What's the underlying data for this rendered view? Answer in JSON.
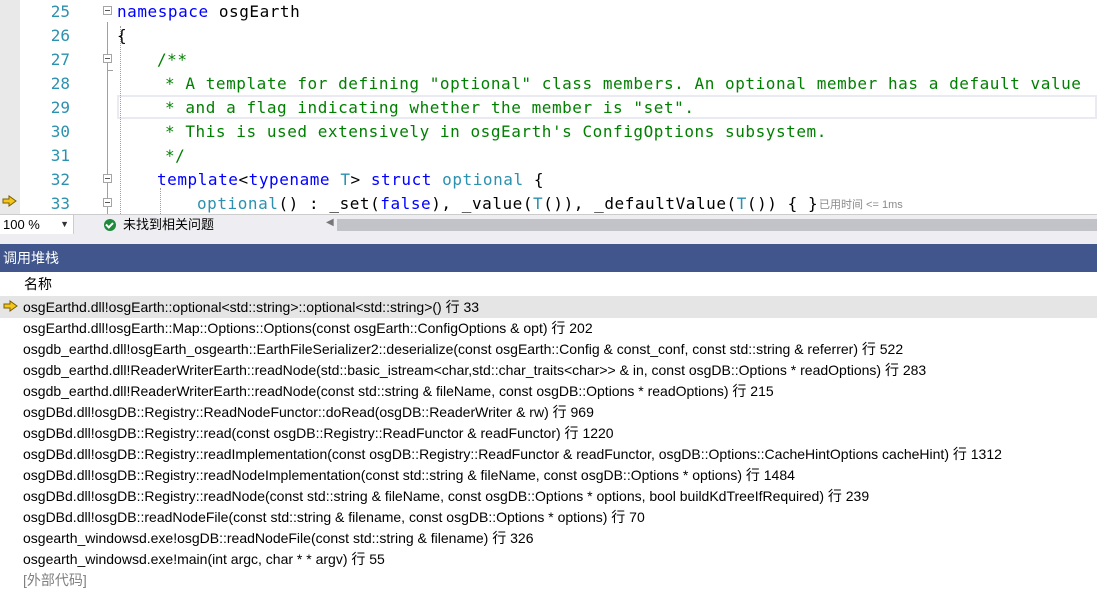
{
  "editor": {
    "lines": [
      {
        "num": "25",
        "tokens": [
          {
            "t": "namespace",
            "c": "kw"
          },
          {
            "t": " osgEarth",
            "c": "pl"
          }
        ]
      },
      {
        "num": "26",
        "tokens": [
          {
            "t": "{",
            "c": "pl"
          }
        ]
      },
      {
        "num": "27",
        "tokens": [
          {
            "t": "/**",
            "c": "cm"
          }
        ]
      },
      {
        "num": "28",
        "tokens": [
          {
            "t": "* A template for defining \"optional\" class members. An optional member has a default value",
            "c": "cm"
          }
        ]
      },
      {
        "num": "29",
        "tokens": [
          {
            "t": "* and a flag indicating whether the member is \"set\".",
            "c": "cm"
          }
        ]
      },
      {
        "num": "30",
        "tokens": [
          {
            "t": "* This is used extensively in osgEarth's ConfigOptions subsystem.",
            "c": "cm"
          }
        ]
      },
      {
        "num": "31",
        "tokens": [
          {
            "t": "*/",
            "c": "cm"
          }
        ]
      },
      {
        "num": "32",
        "tokens": [
          {
            "t": "template",
            "c": "kw"
          },
          {
            "t": "<",
            "c": "pl"
          },
          {
            "t": "typename",
            "c": "kw"
          },
          {
            "t": " ",
            "c": "pl"
          },
          {
            "t": "T",
            "c": "tp"
          },
          {
            "t": "> ",
            "c": "pl"
          },
          {
            "t": "struct",
            "c": "kw"
          },
          {
            "t": " ",
            "c": "pl"
          },
          {
            "t": "optional",
            "c": "tp"
          },
          {
            "t": " {",
            "c": "pl"
          }
        ]
      },
      {
        "num": "33",
        "tokens": [
          {
            "t": "optional",
            "c": "tp"
          },
          {
            "t": "() : _set(",
            "c": "pl"
          },
          {
            "t": "false",
            "c": "kw"
          },
          {
            "t": "), _value(",
            "c": "pl"
          },
          {
            "t": "T",
            "c": "tp"
          },
          {
            "t": "()), _defaultValue(",
            "c": "pl"
          },
          {
            "t": "T",
            "c": "tp"
          },
          {
            "t": "()) { }",
            "c": "pl"
          }
        ]
      }
    ],
    "elapsed_hint": "已用时间 <= 1ms"
  },
  "status": {
    "zoom": "100 %",
    "issues": "未找到相关问题"
  },
  "callstack": {
    "title": "调用堆栈",
    "column_name": "名称",
    "frames": [
      "osgEarthd.dll!osgEarth::optional<std::string>::optional<std::string>() 行 33",
      "osgEarthd.dll!osgEarth::Map::Options::Options(const osgEarth::ConfigOptions & opt) 行 202",
      "osgdb_earthd.dll!osgEarth_osgearth::EarthFileSerializer2::deserialize(const osgEarth::Config & const_conf, const std::string & referrer) 行 522",
      "osgdb_earthd.dll!ReaderWriterEarth::readNode(std::basic_istream<char,std::char_traits<char>> & in, const osgDB::Options * readOptions) 行 283",
      "osgdb_earthd.dll!ReaderWriterEarth::readNode(const std::string & fileName, const osgDB::Options * readOptions) 行 215",
      "osgDBd.dll!osgDB::Registry::ReadNodeFunctor::doRead(osgDB::ReaderWriter & rw) 行 969",
      "osgDBd.dll!osgDB::Registry::read(const osgDB::Registry::ReadFunctor & readFunctor) 行 1220",
      "osgDBd.dll!osgDB::Registry::readImplementation(const osgDB::Registry::ReadFunctor & readFunctor, osgDB::Options::CacheHintOptions cacheHint) 行 1312",
      "osgDBd.dll!osgDB::Registry::readNodeImplementation(const std::string & fileName, const osgDB::Options * options) 行 1484",
      "osgDBd.dll!osgDB::Registry::readNode(const std::string & fileName, const osgDB::Options * options, bool buildKdTreeIfRequired) 行 239",
      "osgDBd.dll!osgDB::readNodeFile(const std::string & filename, const osgDB::Options * options) 行 70",
      "osgearth_windowsd.exe!osgDB::readNodeFile(const std::string & filename) 行 326",
      "osgearth_windowsd.exe!main(int argc, char * * argv) 行 55"
    ],
    "external": "[外部代码]"
  },
  "colors": {
    "keyword": "#0000ff",
    "type": "#2b91af",
    "comment": "#008000",
    "panel_title_bg": "#40568d",
    "pointer": "#f5c518"
  }
}
